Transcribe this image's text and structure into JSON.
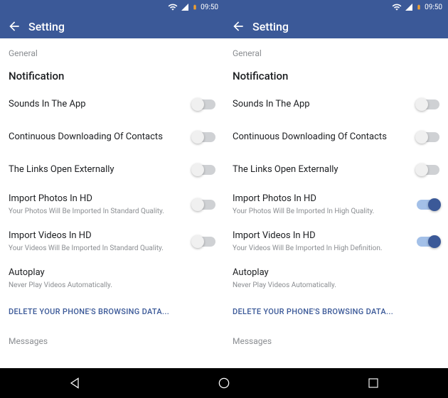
{
  "status": {
    "time": "09:50"
  },
  "appbar": {
    "title": "Setting"
  },
  "general_label": "General",
  "notification_header": "Notification",
  "rows": {
    "sounds": {
      "title": "Sounds In The App"
    },
    "contacts": {
      "title": "Continuous Downloading Of Contacts"
    },
    "links": {
      "title": "The Links Open Externally"
    },
    "importPhotos": {
      "title": "Import Photos In HD",
      "sub_off": "Your Photos Will Be Imported In Standard Quality.",
      "sub_on": "Your Photos Will Be Imported In High Quality."
    },
    "importVideos": {
      "title": "Import Videos In HD",
      "sub_off": "Your Videos Will Be Imported In Standard Quality.",
      "sub_on": "Your Videos Will Be Imported In High Definition."
    },
    "autoplay": {
      "title": "Autoplay",
      "sub": "Never Play Videos Automatically."
    }
  },
  "delete_link": "DELETE YOUR PHONE'S BROWSING DATA...",
  "messages_label": "Messages"
}
